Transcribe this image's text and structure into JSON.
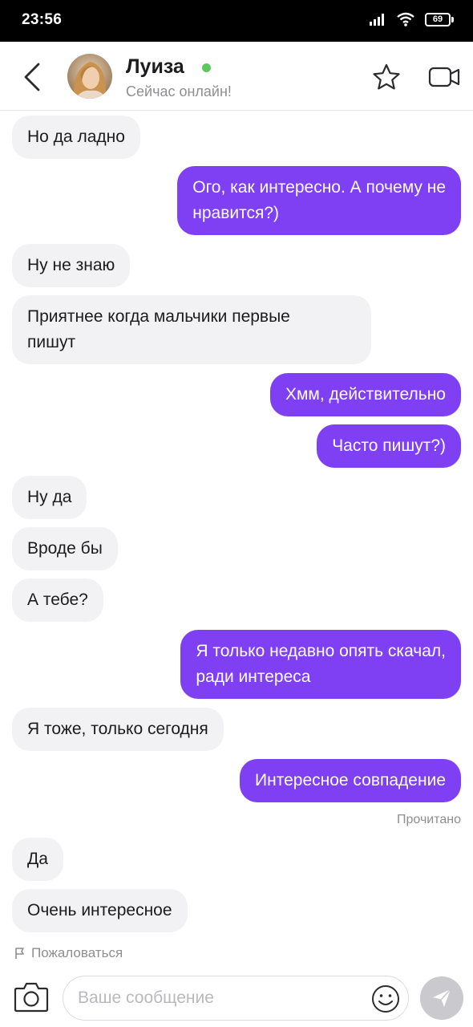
{
  "status_bar": {
    "time": "23:56",
    "battery": "69",
    "icons": [
      "signal-icon",
      "wifi-icon",
      "battery-icon"
    ]
  },
  "header": {
    "contact_name": "Луиза",
    "status_text": "Сейчас онлайн!",
    "online_color": "#5ac85a",
    "icons": [
      "back-arrow-icon",
      "star-icon",
      "video-camera-icon"
    ]
  },
  "colors": {
    "outgoing_bubble": "#7f3ff2",
    "incoming_bubble": "#f2f2f4"
  },
  "messages": [
    {
      "dir": "in",
      "text": "Но да ладно"
    },
    {
      "dir": "out",
      "lines": [
        "Ого, как интересно. А почему не",
        "нравится?)"
      ]
    },
    {
      "dir": "in",
      "text": "Ну не знаю"
    },
    {
      "dir": "in",
      "lines": [
        "Приятнее когда мальчики первые",
        "пишут"
      ]
    },
    {
      "dir": "out",
      "text": "Хмм, действительно"
    },
    {
      "dir": "out",
      "text": "Часто пишут?)"
    },
    {
      "dir": "in",
      "text": "Ну да"
    },
    {
      "dir": "in",
      "text": "Вроде бы"
    },
    {
      "dir": "in",
      "text": "А тебе?"
    },
    {
      "dir": "out",
      "lines": [
        "Я только недавно опять скачал,",
        "ради интереса"
      ]
    },
    {
      "dir": "in",
      "text": "Я тоже, только сегодня"
    },
    {
      "dir": "out",
      "text": "Интересное совпадение"
    },
    {
      "dir": "in",
      "text": "Да"
    },
    {
      "dir": "in",
      "text": "Очень интересное"
    }
  ],
  "read_receipt": "Прочитано",
  "report_label": "Пожаловаться",
  "composer": {
    "placeholder": "Ваше сообщение",
    "value": "",
    "icons": [
      "camera-icon",
      "emoji-icon",
      "send-icon"
    ]
  }
}
